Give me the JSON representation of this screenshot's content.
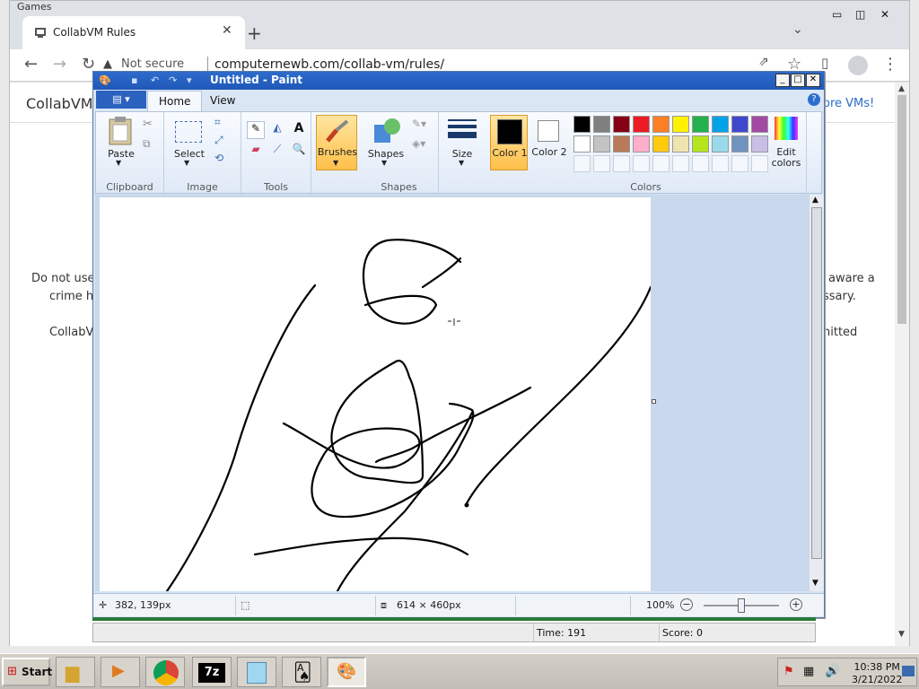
{
  "browser": {
    "caption": "Games",
    "tab_title": "CollabVM Rules",
    "not_secure": "Not secure",
    "url": "computernewb.com/collab-vm/rules/"
  },
  "page": {
    "heading_left": "CollabVM",
    "heading_right": "ore VMs!",
    "line1_left": "Do not use",
    "line1_right": "aware a",
    "line2_left": "crime ha",
    "line2_right": "ssary.",
    "line3_left": "CollabV",
    "line3_right": "nitted"
  },
  "paint": {
    "title": "Untitled - Paint",
    "tabs": [
      "Home",
      "View"
    ],
    "groups": {
      "clipboard": "Clipboard",
      "image": "Image",
      "tools": "Tools",
      "shapes_group": "Shapes",
      "colors": "Colors"
    },
    "buttons": {
      "paste": "Paste",
      "select": "Select",
      "brushes": "Brushes",
      "shapes": "Shapes",
      "size": "Size",
      "color1": "Color 1",
      "color2": "Color 2",
      "edit_colors": "Edit colors"
    },
    "palette_row1": [
      "#000000",
      "#7f7f7f",
      "#880015",
      "#ed1c24",
      "#ff7f27",
      "#fff200",
      "#22b14c",
      "#00a2e8",
      "#3f48cc",
      "#a349a4"
    ],
    "palette_row2": [
      "#ffffff",
      "#c3c3c3",
      "#b97a57",
      "#ffaec9",
      "#ffc90e",
      "#efe4b0",
      "#b5e61d",
      "#99d9ea",
      "#7092be",
      "#c8bfe7"
    ],
    "status": {
      "cursor": "382, 139px",
      "size": "614 × 460px",
      "zoom": "100%"
    }
  },
  "game": {
    "time": "Time:  191",
    "score": "Score: 0"
  },
  "taskbar": {
    "start": "Start",
    "time": "10:38 PM",
    "date": "3/21/2022"
  }
}
